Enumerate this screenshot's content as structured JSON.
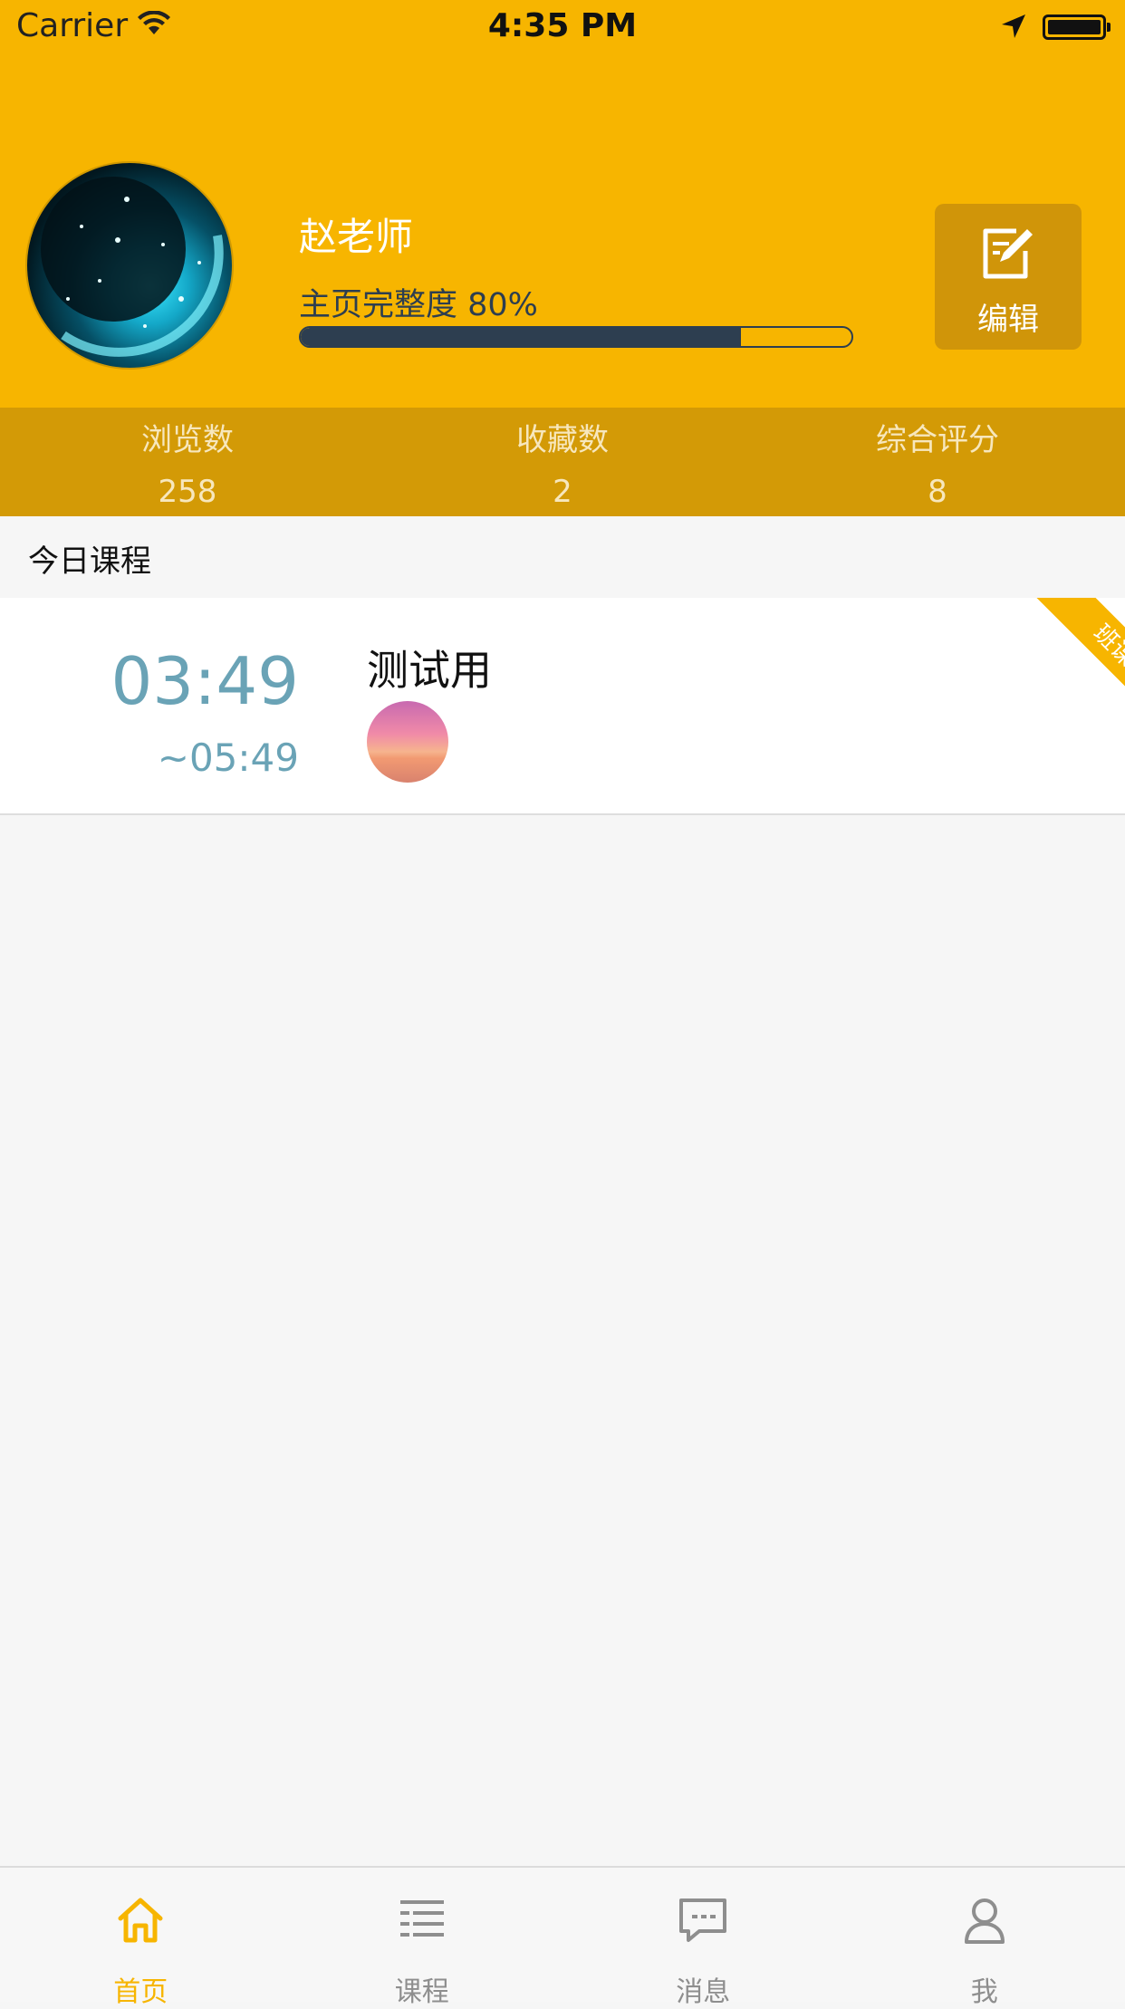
{
  "status_bar": {
    "carrier": "Carrier",
    "time": "4:35 PM"
  },
  "profile": {
    "name": "赵老师",
    "completion_label": "主页完整度 80%",
    "completion_fraction": 0.8,
    "edit_label": "编辑"
  },
  "stats": [
    {
      "label": "浏览数",
      "value": "258"
    },
    {
      "label": "收藏数",
      "value": "2"
    },
    {
      "label": "综合评分",
      "value": "8"
    }
  ],
  "section_title": "今日课程",
  "courses": [
    {
      "start_time": "03:49",
      "end_time": "~05:49",
      "name": "测试用",
      "tag": "班课"
    }
  ],
  "tabbar": [
    {
      "label": "首页",
      "icon": "home-icon",
      "active": true
    },
    {
      "label": "课程",
      "icon": "course-list-icon",
      "active": false
    },
    {
      "label": "消息",
      "icon": "message-icon",
      "active": false
    },
    {
      "label": "我",
      "icon": "user-icon",
      "active": false
    }
  ],
  "colors": {
    "brand": "#f7b500",
    "stats_bar": "#d39a06",
    "progress": "#2d3e50",
    "time_text": "#6aa3b6",
    "tab_inactive": "#8e8e8e"
  }
}
